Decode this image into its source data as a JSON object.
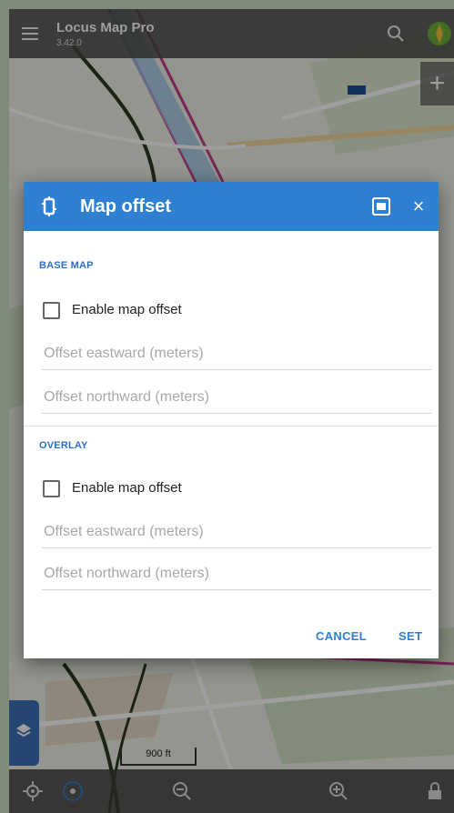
{
  "app": {
    "title": "Locus Map Pro",
    "version": "3.42.0"
  },
  "map": {
    "scale_label": "900 ft"
  },
  "dialog": {
    "title": "Map offset",
    "sections": [
      {
        "title": "BASE MAP",
        "checkbox_label": "Enable map offset",
        "checked": false,
        "fields": [
          {
            "placeholder": "Offset eastward (meters)",
            "value": ""
          },
          {
            "placeholder": "Offset northward (meters)",
            "value": ""
          }
        ]
      },
      {
        "title": "OVERLAY",
        "checkbox_label": "Enable map offset",
        "checked": false,
        "fields": [
          {
            "placeholder": "Offset eastward (meters)",
            "value": ""
          },
          {
            "placeholder": "Offset northward (meters)",
            "value": ""
          }
        ]
      }
    ],
    "buttons": {
      "cancel": "CANCEL",
      "set": "SET"
    }
  },
  "icons": {
    "menu": "menu-icon",
    "search": "search-icon",
    "compass": "compass-icon",
    "zoom_in": "plus-icon",
    "layers": "layers-icon",
    "dialog": "map-offset-icon",
    "help": "help-icon",
    "close": "close-icon",
    "gps": "gps-icon",
    "zoom_out_bottom": "zoom-out-icon",
    "zoom_in_bottom": "zoom-in-icon",
    "lock": "lock-icon"
  },
  "colors": {
    "accent": "#2f7fd3",
    "section_title": "#2f6fc0",
    "header": "#2f7fd3",
    "layers_button": "#3d70b8"
  }
}
